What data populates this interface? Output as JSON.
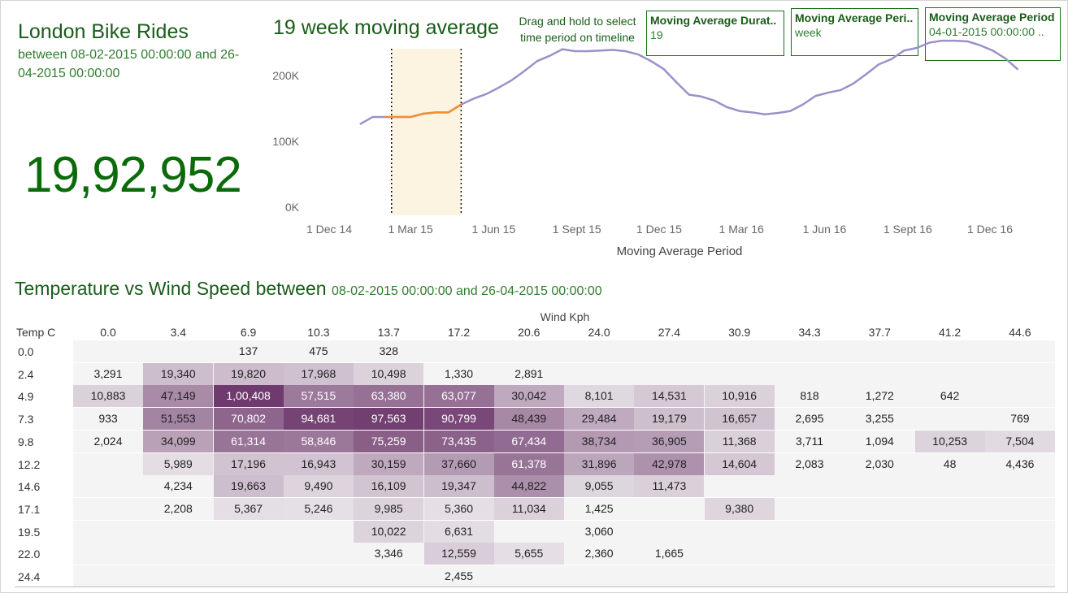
{
  "header": {
    "title": "London Bike Rides",
    "subtitle": "between 08-02-2015 00:00:00 and 26-04-2015 00:00:00",
    "total_rides": "19,92,952"
  },
  "controls": {
    "drag_hint": "Drag and hold to select time period on timeline",
    "params": [
      {
        "label": "Moving Average Durat..",
        "value": "19"
      },
      {
        "label": "Moving Average Peri..",
        "value": "week"
      },
      {
        "label": "Moving Average Period",
        "value": "04-01-2015 00:00:00 .."
      }
    ]
  },
  "colors": {
    "title_green": "#1a5c1a",
    "line_default": "#9a91c9",
    "line_selected": "#f0912e",
    "selection_fill": "#fdf3e1",
    "heat_low": "#f4f4f4",
    "heat_high": "#6f3b6e"
  },
  "chart_data": [
    {
      "type": "line",
      "title": "19 week moving average",
      "xlabel": "Moving Average Period",
      "ylabel": "",
      "x_ticks": [
        "1 Dec 14",
        "1 Mar 15",
        "1 Jun 15",
        "1 Sept 15",
        "1 Dec 15",
        "1 Mar 16",
        "1 Jun 16",
        "1 Sept 16",
        "1 Dec 16"
      ],
      "y_ticks": [
        "0K",
        "100K",
        "200K"
      ],
      "ylim": [
        0,
        260000
      ],
      "x_start": "2015-01-04",
      "x_end": "2017-01-01",
      "selected_range": [
        "2015-02-08",
        "2015-04-26"
      ],
      "series": [
        {
          "x": [
            "2015-01-04",
            "2015-01-18",
            "2015-02-01",
            "2015-02-15",
            "2015-03-01",
            "2015-03-15",
            "2015-03-29",
            "2015-04-12",
            "2015-04-26",
            "2015-05-10",
            "2015-05-24",
            "2015-06-07",
            "2015-06-21",
            "2015-07-05",
            "2015-07-19",
            "2015-08-02",
            "2015-08-16",
            "2015-08-30",
            "2015-09-13",
            "2015-09-27",
            "2015-10-11",
            "2015-10-25",
            "2015-11-08",
            "2015-11-22",
            "2015-12-06",
            "2015-12-20",
            "2016-01-03",
            "2016-01-17",
            "2016-01-31",
            "2016-02-14",
            "2016-02-28",
            "2016-03-13",
            "2016-03-27",
            "2016-04-10",
            "2016-04-24",
            "2016-05-08",
            "2016-05-22",
            "2016-06-05",
            "2016-06-19",
            "2016-07-03",
            "2016-07-17",
            "2016-07-31",
            "2016-08-14",
            "2016-08-28",
            "2016-09-11",
            "2016-09-25",
            "2016-10-09",
            "2016-10-23",
            "2016-11-06",
            "2016-11-20",
            "2016-12-04",
            "2016-12-18",
            "2017-01-01"
          ],
          "values": [
            126000,
            137000,
            137000,
            137000,
            137000,
            142000,
            144000,
            144000,
            156000,
            165000,
            172000,
            182000,
            193000,
            207000,
            222000,
            230000,
            240000,
            237000,
            237000,
            238000,
            239000,
            237000,
            232000,
            222000,
            210000,
            190000,
            171000,
            168000,
            162000,
            152000,
            146000,
            144000,
            141000,
            143000,
            146000,
            156000,
            169000,
            174000,
            178000,
            188000,
            202000,
            217000,
            225000,
            238000,
            242000,
            250000,
            253000,
            253000,
            252000,
            246000,
            238000,
            226000,
            209000
          ]
        }
      ]
    },
    {
      "type": "heatmap",
      "title": "Temperature vs Wind Speed between",
      "subtitle": "08-02-2015 00:00:00 and 26-04-2015 00:00:00",
      "xlabel": "Wind Kph",
      "ylabel": "Temp C",
      "x": [
        "0.0",
        "3.4",
        "6.9",
        "10.3",
        "13.7",
        "17.2",
        "20.6",
        "24.0",
        "27.4",
        "30.9",
        "34.3",
        "37.7",
        "41.2",
        "44.6"
      ],
      "y": [
        "0.0",
        "2.4",
        "4.9",
        "7.3",
        "9.8",
        "12.2",
        "14.6",
        "17.1",
        "19.5",
        "22.0",
        "24.4"
      ],
      "values": [
        [
          null,
          null,
          137,
          475,
          328,
          null,
          null,
          null,
          null,
          null,
          null,
          null,
          null,
          null
        ],
        [
          3291,
          19340,
          19820,
          17968,
          10498,
          1330,
          2891,
          null,
          null,
          null,
          null,
          null,
          null,
          null
        ],
        [
          10883,
          47149,
          100408,
          57515,
          63380,
          63077,
          30042,
          8101,
          14531,
          10916,
          818,
          1272,
          642,
          null
        ],
        [
          933,
          51553,
          70802,
          94681,
          97563,
          90799,
          48439,
          29484,
          19179,
          16657,
          2695,
          3255,
          null,
          769
        ],
        [
          2024,
          34099,
          61314,
          58846,
          75259,
          73435,
          67434,
          38734,
          36905,
          11368,
          3711,
          1094,
          10253,
          7504
        ],
        [
          null,
          5989,
          17196,
          16943,
          30159,
          37660,
          61378,
          31896,
          42978,
          14604,
          2083,
          2030,
          48,
          4436
        ],
        [
          null,
          4234,
          19663,
          9490,
          16109,
          19347,
          44822,
          9055,
          11473,
          null,
          null,
          null,
          null,
          null
        ],
        [
          null,
          2208,
          5367,
          5246,
          9985,
          5360,
          11034,
          1425,
          null,
          9380,
          null,
          null,
          null,
          null
        ],
        [
          null,
          null,
          null,
          null,
          10022,
          6631,
          null,
          3060,
          null,
          null,
          null,
          null,
          null,
          null
        ],
        [
          null,
          null,
          null,
          null,
          3346,
          12559,
          5655,
          2360,
          1665,
          null,
          null,
          null,
          null,
          null
        ],
        [
          null,
          null,
          null,
          null,
          null,
          2455,
          null,
          null,
          null,
          null,
          null,
          null,
          null,
          null
        ]
      ],
      "labels": [
        [
          "",
          "",
          "137",
          "475",
          "328",
          "",
          "",
          "",
          "",
          "",
          "",
          "",
          "",
          ""
        ],
        [
          "3,291",
          "19,340",
          "19,820",
          "17,968",
          "10,498",
          "1,330",
          "2,891",
          "",
          "",
          "",
          "",
          "",
          "",
          ""
        ],
        [
          "10,883",
          "47,149",
          "1,00,408",
          "57,515",
          "63,380",
          "63,077",
          "30,042",
          "8,101",
          "14,531",
          "10,916",
          "818",
          "1,272",
          "642",
          ""
        ],
        [
          "933",
          "51,553",
          "70,802",
          "94,681",
          "97,563",
          "90,799",
          "48,439",
          "29,484",
          "19,179",
          "16,657",
          "2,695",
          "3,255",
          "",
          "769"
        ],
        [
          "2,024",
          "34,099",
          "61,314",
          "58,846",
          "75,259",
          "73,435",
          "67,434",
          "38,734",
          "36,905",
          "11,368",
          "3,711",
          "1,094",
          "10,253",
          "7,504"
        ],
        [
          "",
          "5,989",
          "17,196",
          "16,943",
          "30,159",
          "37,660",
          "61,378",
          "31,896",
          "42,978",
          "14,604",
          "2,083",
          "2,030",
          "48",
          "4,436"
        ],
        [
          "",
          "4,234",
          "19,663",
          "9,490",
          "16,109",
          "19,347",
          "44,822",
          "9,055",
          "11,473",
          "",
          "",
          "",
          "",
          ""
        ],
        [
          "",
          "2,208",
          "5,367",
          "5,246",
          "9,985",
          "5,360",
          "11,034",
          "1,425",
          "",
          "9,380",
          "",
          "",
          "",
          ""
        ],
        [
          "",
          "",
          "",
          "",
          "10,022",
          "6,631",
          "",
          "3,060",
          "",
          "",
          "",
          "",
          "",
          ""
        ],
        [
          "",
          "",
          "",
          "",
          "3,346",
          "12,559",
          "5,655",
          "2,360",
          "1,665",
          "",
          "",
          "",
          "",
          ""
        ],
        [
          "",
          "",
          "",
          "",
          "",
          "2,455",
          "",
          "",
          "",
          "",
          "",
          "",
          "",
          ""
        ]
      ]
    }
  ]
}
